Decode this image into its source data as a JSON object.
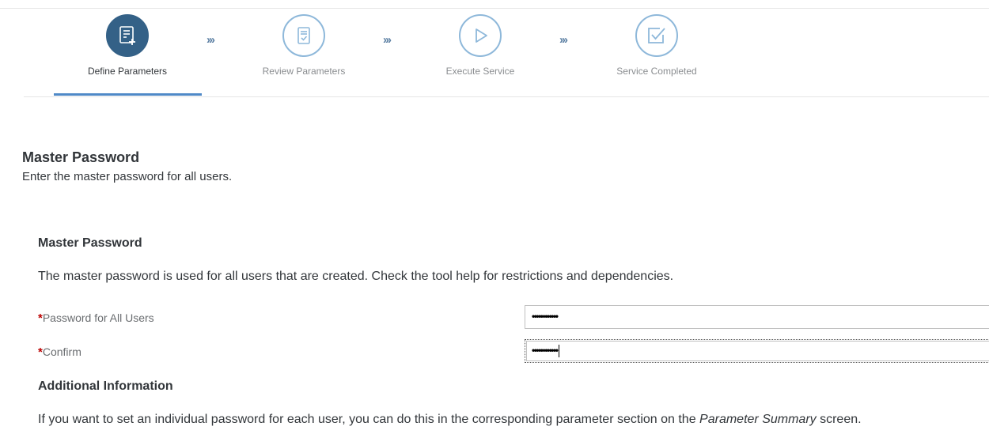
{
  "wizard": {
    "steps": [
      {
        "label": "Define Parameters",
        "icon": "define-parameters-icon",
        "state": "active"
      },
      {
        "label": "Review Parameters",
        "icon": "review-parameters-icon",
        "state": "inactive"
      },
      {
        "label": "Execute Service",
        "icon": "execute-service-icon",
        "state": "inactive"
      },
      {
        "label": "Service Completed",
        "icon": "service-completed-icon",
        "state": "inactive"
      }
    ],
    "separator": "›››"
  },
  "section": {
    "title": "Master Password",
    "description": "Enter the master password for all users."
  },
  "group": {
    "title": "Master Password",
    "description": "The master password is used for all users that are created. Check the tool help for restrictions and dependencies."
  },
  "fields": {
    "required_marker": "*",
    "password_label": "Password for All Users",
    "password_value": "••••••••••••",
    "confirm_label": "Confirm",
    "confirm_value": "••••••••••••"
  },
  "info": {
    "title": "Additional Information",
    "text_before": "If you want to set an individual password for each user, you can do this in the corresponding parameter section on the ",
    "text_emphasis": "Parameter Summary",
    "text_after": " screen."
  },
  "colors": {
    "active_step": "#346187",
    "inactive_step_border": "#8eb8da",
    "required": "#bb0000"
  }
}
